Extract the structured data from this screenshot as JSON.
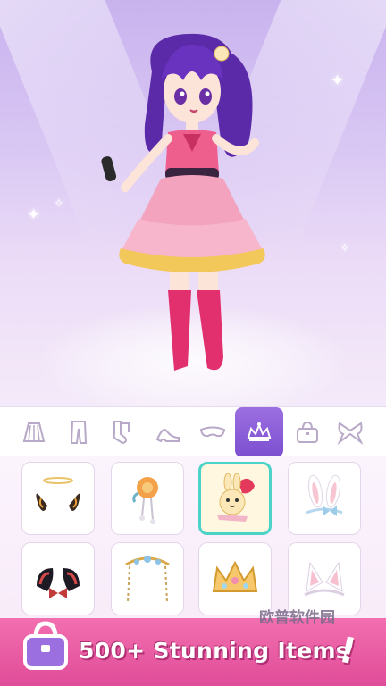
{
  "colors": {
    "accent": "#7b4fd0",
    "banner": "#e04c98",
    "selected_border": "#4cd3c8"
  },
  "categories": [
    {
      "icon": "skirt-icon"
    },
    {
      "icon": "pants-icon"
    },
    {
      "icon": "socks-icon"
    },
    {
      "icon": "high-heel-icon"
    },
    {
      "icon": "mask-icon"
    },
    {
      "icon": "tiara-icon",
      "active": true
    },
    {
      "icon": "handbag-icon"
    },
    {
      "icon": "bow-icon"
    }
  ],
  "items": [
    {
      "icon": "halo-butterfly-icon"
    },
    {
      "icon": "flower-hairpin-icon"
    },
    {
      "icon": "bunny-clip-icon",
      "selected": true
    },
    {
      "icon": "bunny-ears-icon"
    },
    {
      "icon": "bat-ears-icon"
    },
    {
      "icon": "veil-tiara-icon"
    },
    {
      "icon": "crown-icon"
    },
    {
      "icon": "cat-ears-icon"
    }
  ],
  "banner": {
    "text": "500+ Stunning Items",
    "exclaim": "!"
  },
  "watermark": "欧普软件园"
}
